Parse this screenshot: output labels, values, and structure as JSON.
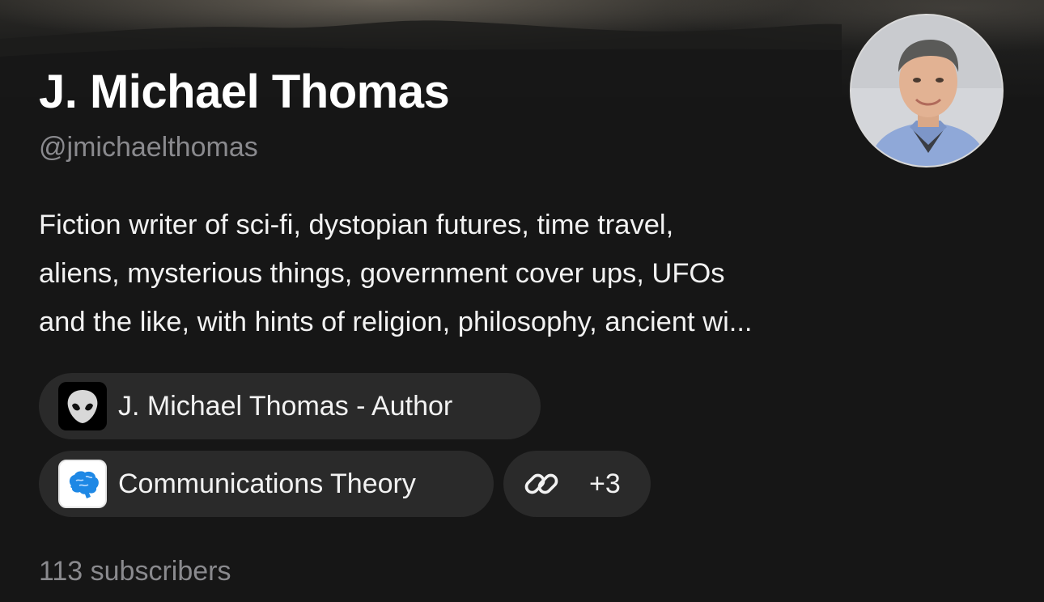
{
  "profile": {
    "name": "J. Michael Thomas",
    "handle": "@jmichaelthomas",
    "bio_lines": [
      "Fiction writer of sci-fi, dystopian futures, time travel,",
      "aliens, mysterious things, government cover ups, UFOs",
      "and the like, with hints of religion, philosophy, ancient wi..."
    ],
    "avatar_icon": "profile-photo"
  },
  "publications": [
    {
      "label": "J. Michael Thomas - Author",
      "icon": "alien-head-icon"
    },
    {
      "label": "Communications Theory",
      "icon": "blue-brain-icon"
    }
  ],
  "links": {
    "icon": "link-icon",
    "count": "+3"
  },
  "stats": {
    "subscribers": "113 subscribers"
  },
  "colors": {
    "background": "#161616",
    "chip_background": "#2a2a2a",
    "secondary_text": "#8a8a8e",
    "primary_text": "#ffffff",
    "brain_blue": "#1e88e5"
  }
}
